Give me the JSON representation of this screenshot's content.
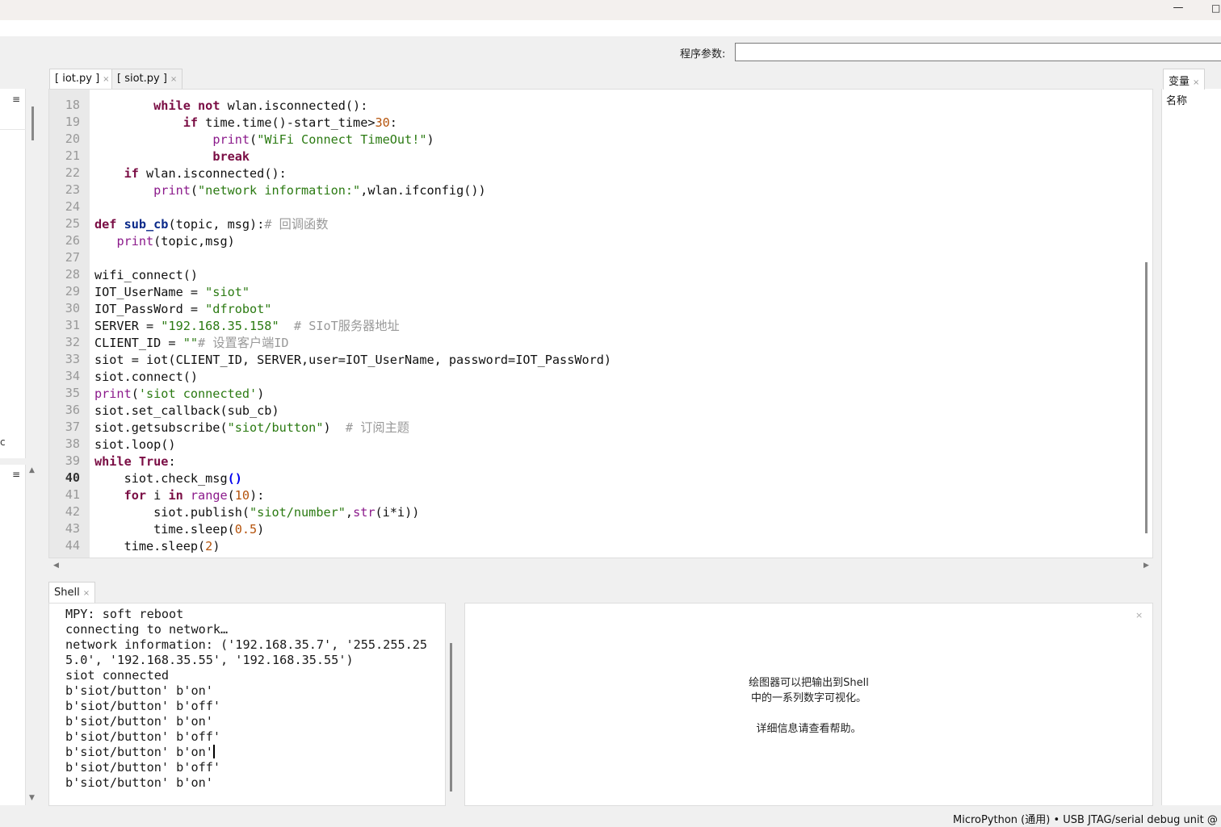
{
  "window": {
    "minimize_glyph": "—",
    "maximize_glyph": "□"
  },
  "args": {
    "label": "程序参数:",
    "value": ""
  },
  "editor": {
    "tabs": [
      {
        "label": "[ iot.py ]",
        "close": "×"
      },
      {
        "label": "[ siot.py ]",
        "close": "×"
      }
    ],
    "current_line": "40",
    "line_numbers": [
      "18",
      "19",
      "20",
      "21",
      "22",
      "23",
      "24",
      "25",
      "26",
      "27",
      "28",
      "29",
      "30",
      "31",
      "32",
      "33",
      "34",
      "35",
      "36",
      "37",
      "38",
      "39",
      "40",
      "41",
      "42",
      "43",
      "44"
    ]
  },
  "variables": {
    "tab_label": "变量",
    "close": "×",
    "column_name": "名称"
  },
  "shell": {
    "tab_label": "Shell",
    "close": "×",
    "lines": [
      "MPY: soft reboot",
      "connecting to network…",
      "network information: ('192.168.35.7', '255.255.25",
      "5.0', '192.168.35.55', '192.168.35.55')",
      "siot connected",
      "b'siot/button' b'on'",
      "b'siot/button' b'off'",
      "b'siot/button' b'on'",
      "b'siot/button' b'off'",
      "b'siot/button' b'on'",
      "b'siot/button' b'off'",
      "b'siot/button' b'on'"
    ]
  },
  "plotter": {
    "close": "×",
    "message_line1": "绘图器可以把输出到Shell",
    "message_line2": "中的一系列数字可视化。",
    "message_line3": "详细信息请查看帮助。"
  },
  "statusbar": {
    "text": "MicroPython (通用)  •  USB JTAG/serial debug unit @ COM"
  },
  "left_panel": {
    "menu_glyph": "≡",
    "stray_char": "c"
  }
}
